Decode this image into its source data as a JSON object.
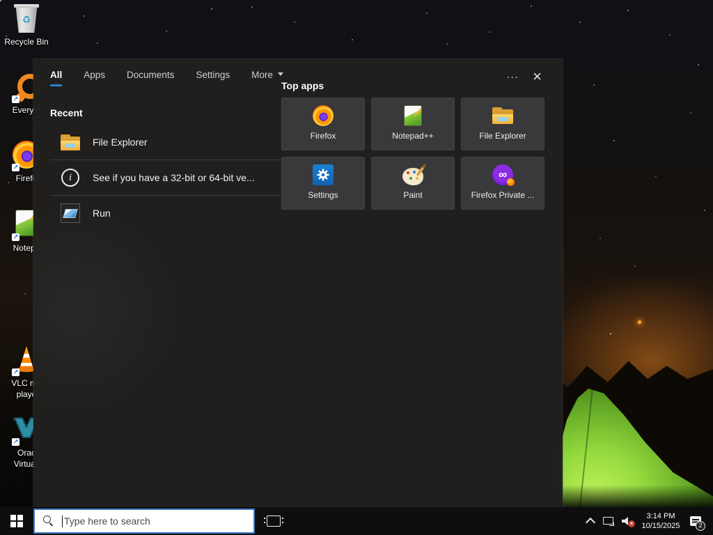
{
  "search_panel": {
    "tabs": {
      "all": "All",
      "apps": "Apps",
      "documents": "Documents",
      "settings": "Settings",
      "more": "More"
    },
    "recent": {
      "title": "Recent",
      "items": [
        {
          "label": "File Explorer",
          "icon": "folder-icon"
        },
        {
          "label": "See if you have a 32-bit or 64-bit ve...",
          "icon": "info-icon"
        },
        {
          "label": "Run",
          "icon": "run-window-icon"
        }
      ]
    },
    "top_apps": {
      "title": "Top apps",
      "apps": [
        {
          "label": "Firefox",
          "icon": "firefox-icon"
        },
        {
          "label": "Notepad++",
          "icon": "notepadpp-icon"
        },
        {
          "label": "File Explorer",
          "icon": "folder-icon"
        },
        {
          "label": "Settings",
          "icon": "gear-icon"
        },
        {
          "label": "Paint",
          "icon": "palette-icon"
        },
        {
          "label": "Firefox Private ...",
          "icon": "mask-icon"
        }
      ]
    }
  },
  "desktop": {
    "icons": [
      {
        "label": "Recycle Bin",
        "icon": "recycle-bin-icon"
      },
      {
        "label": "Everyth",
        "icon": "everything-icon"
      },
      {
        "label": "Firefo",
        "icon": "firefox-icon"
      },
      {
        "label": "Notepa",
        "icon": "notepadpp-icon"
      },
      {
        "label": "VLC me",
        "label2": "playe",
        "icon": "vlc-cone-icon"
      },
      {
        "label": "Orac",
        "label2": "Virtuall",
        "icon": "virtualbox-icon"
      }
    ]
  },
  "taskbar": {
    "search_placeholder": "Type here to search",
    "clock": {
      "time": "3:14 PM",
      "date": "10/15/2025"
    },
    "notification_badge": "2"
  },
  "glyphs": {
    "ellipsis": "···",
    "close": "×",
    "infinity": "∞",
    "recycle": "♻",
    "shortcut_arrow": "↗",
    "info": "i"
  },
  "colors": {
    "accent_blue": "#2f7cd4",
    "search_border": "#3f7ec6",
    "tent_green": "#8ed53a",
    "taskbar_black": "#0e0e10",
    "panel_dark": "#211f1d"
  }
}
